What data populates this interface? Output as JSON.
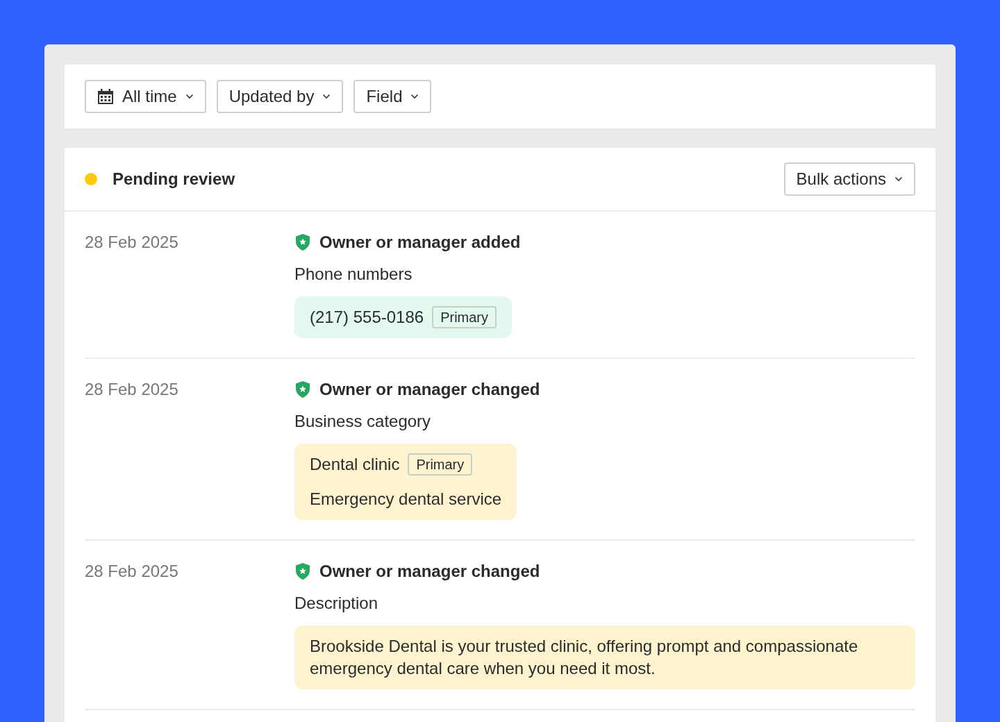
{
  "filters": [
    {
      "label": "All time",
      "kind": "date"
    },
    {
      "label": "Updated by",
      "kind": "plain"
    },
    {
      "label": "Field",
      "kind": "plain"
    }
  ],
  "section": {
    "color": "#fccc0a",
    "title": "Pending review",
    "bulk_actions": "Bulk actions"
  },
  "entries": [
    {
      "date": "28 Feb 2025",
      "kind": "added",
      "title": "Owner or manager added",
      "field": "Phone numbers",
      "values": [
        {
          "text": "(217) 555-0186",
          "tag": "Primary"
        }
      ]
    },
    {
      "date": "28 Feb 2025",
      "kind": "changed",
      "title": "Owner or manager changed",
      "field": "Business category",
      "values": [
        {
          "text": "Dental clinic",
          "tag": "Primary"
        },
        {
          "text": "Emergency dental service"
        }
      ]
    },
    {
      "date": "28 Feb 2025",
      "kind": "changed",
      "title": "Owner or manager changed",
      "field": "Description",
      "values": [
        {
          "text": "Brookside Dental is your trusted clinic, offering prompt and compassionate emergency dental care when you need it most."
        }
      ]
    }
  ]
}
